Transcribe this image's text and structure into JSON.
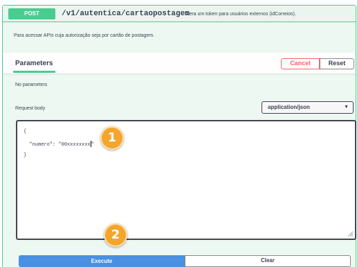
{
  "operation": {
    "method": "POST",
    "path": "/v1/autentica/cartaopostagem",
    "summary": "Gera um token para usuários externos (idCorreios).",
    "description": "Para acessar APIs cuja autorização seja por cartão de postagem."
  },
  "parameters": {
    "title": "Parameters",
    "cancel_label": "Cancel",
    "reset_label": "Reset",
    "empty_text": "No parameters"
  },
  "request_body": {
    "label": "Request body",
    "content_type": "application/json",
    "code": {
      "open_brace": "{",
      "key": "\"numero\":",
      "value": "\"00xxxxxxxx",
      "value_end": "\"",
      "close_brace": "}"
    }
  },
  "annotations": {
    "badge_1": "1",
    "badge_2": "2"
  },
  "actions": {
    "execute_label": "Execute",
    "clear_label": "Clear"
  },
  "colors": {
    "post_green": "#49cc90",
    "cancel_red": "#ff6060",
    "execute_blue": "#4990e2",
    "badge_orange": "#f4a52b"
  }
}
